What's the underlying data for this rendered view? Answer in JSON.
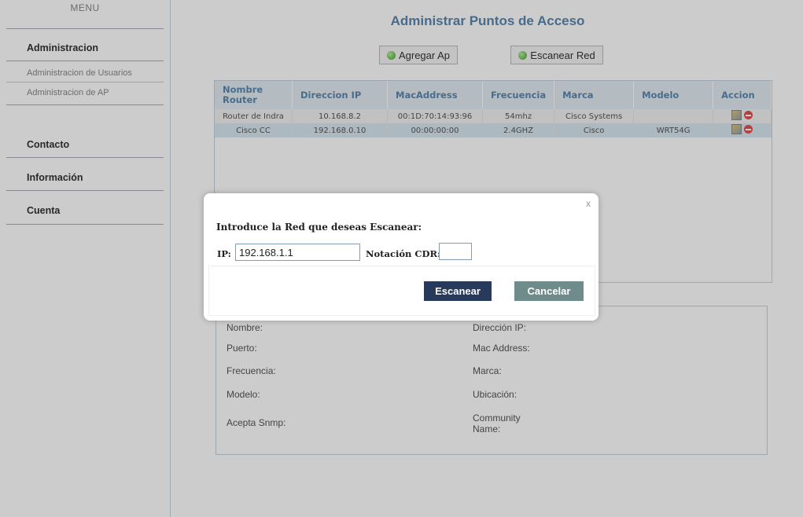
{
  "sidebar": {
    "menu_title": "MENU",
    "administracion": "Administracion",
    "sub_usuarios": "Administracion de Usuarios",
    "sub_ap": "Administracion de AP",
    "contacto": "Contacto",
    "informacion": "Información",
    "cuenta": "Cuenta"
  },
  "main": {
    "title": "Administrar Puntos de Acceso",
    "add_ap_label": "Agregar Ap",
    "scan_label": "Escanear Red"
  },
  "grid": {
    "headers": [
      "Nombre Router",
      "Direccion IP",
      "MacAddress",
      "Frecuencia",
      "Marca",
      "Modelo",
      "Accion"
    ],
    "rows": [
      [
        "Router de Indra",
        "10.168.8.2",
        "00:1D:70:14:93:96",
        "54mhz",
        "Cisco Systems",
        ""
      ],
      [
        "Cisco CC",
        "192.168.0.10",
        "00:00:00:00",
        "2.4GHZ",
        "Cisco",
        "WRT54G"
      ]
    ]
  },
  "details": {
    "nombre": "Nombre:",
    "puerto": "Puerto:",
    "frecuencia": "Frecuencia:",
    "modelo": "Modelo:",
    "snmp": "Acepta Snmp:",
    "ip": "Dirección IP:",
    "mac": "Mac Address:",
    "marca": "Marca:",
    "ubicacion": "Ubicación:",
    "community": "Community Name:"
  },
  "modal": {
    "close": "x",
    "heading": "Introduce la Red que deseas Escanear:",
    "ip_label": "IP:",
    "ip_value": "192.168.1.1",
    "cdr_label": "Notación CDR:",
    "cdr_value": "",
    "scan_button": "Escanear",
    "cancel_button": "Cancelar"
  }
}
